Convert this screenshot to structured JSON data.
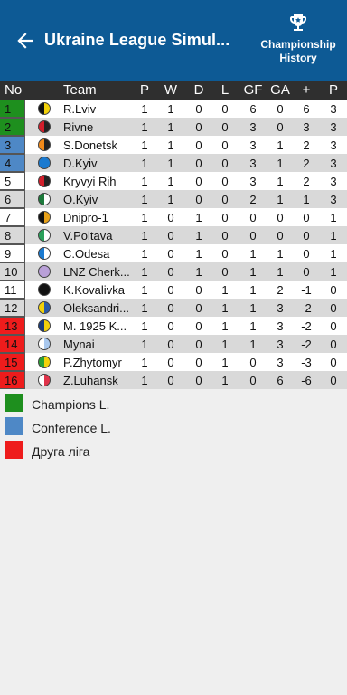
{
  "appbar": {
    "title": "Ukraine League Simul...",
    "history_label_1": "Championship",
    "history_label_2": "History",
    "color": "#0d5a95"
  },
  "columns": {
    "no": "No",
    "team": "Team",
    "p": "P",
    "w": "W",
    "d": "D",
    "l": "L",
    "gf": "GF",
    "ga": "GA",
    "pm": "+",
    "pts": "P"
  },
  "rows": [
    {
      "no": "1",
      "team": "R.Lviv",
      "p": "1",
      "w": "1",
      "d": "0",
      "l": "0",
      "gf": "6",
      "ga": "0",
      "pm": "6",
      "pts": "3",
      "zone": "#1e8f1e",
      "logo": [
        "#111111",
        "#f2d10a"
      ]
    },
    {
      "no": "2",
      "team": "Rivne",
      "p": "1",
      "w": "1",
      "d": "0",
      "l": "0",
      "gf": "3",
      "ga": "0",
      "pm": "3",
      "pts": "3",
      "zone": "#1e8f1e",
      "logo": [
        "#d21e2b",
        "#222222"
      ]
    },
    {
      "no": "3",
      "team": "S.Donetsk",
      "p": "1",
      "w": "1",
      "d": "0",
      "l": "0",
      "gf": "3",
      "ga": "1",
      "pm": "2",
      "pts": "3",
      "zone": "#4e88c6",
      "logo": [
        "#f28a1a",
        "#222222"
      ]
    },
    {
      "no": "4",
      "team": "D.Kyiv",
      "p": "1",
      "w": "1",
      "d": "0",
      "l": "0",
      "gf": "3",
      "ga": "1",
      "pm": "2",
      "pts": "3",
      "zone": "#4e88c6",
      "logo": [
        "#1a7ad0",
        "#1a7ad0"
      ]
    },
    {
      "no": "5",
      "team": "Kryvyi Rih",
      "p": "1",
      "w": "1",
      "d": "0",
      "l": "0",
      "gf": "3",
      "ga": "1",
      "pm": "2",
      "pts": "3",
      "zone": "",
      "logo": [
        "#d21e2b",
        "#222222"
      ]
    },
    {
      "no": "6",
      "team": "O.Kyiv",
      "p": "1",
      "w": "1",
      "d": "0",
      "l": "0",
      "gf": "2",
      "ga": "1",
      "pm": "1",
      "pts": "3",
      "zone": "",
      "logo": [
        "#1c7a3b",
        "#ffffff"
      ]
    },
    {
      "no": "7",
      "team": "Dnipro-1",
      "p": "1",
      "w": "0",
      "d": "1",
      "l": "0",
      "gf": "0",
      "ga": "0",
      "pm": "0",
      "pts": "1",
      "zone": "",
      "logo": [
        "#111111",
        "#e8a21a"
      ]
    },
    {
      "no": "8",
      "team": "V.Poltava",
      "p": "1",
      "w": "0",
      "d": "1",
      "l": "0",
      "gf": "0",
      "ga": "0",
      "pm": "0",
      "pts": "1",
      "zone": "",
      "logo": [
        "#2aa05a",
        "#ffffff"
      ]
    },
    {
      "no": "9",
      "team": "C.Odesa",
      "p": "1",
      "w": "0",
      "d": "1",
      "l": "0",
      "gf": "1",
      "ga": "1",
      "pm": "0",
      "pts": "1",
      "zone": "",
      "logo": [
        "#1a7ad0",
        "#ffffff"
      ]
    },
    {
      "no": "10",
      "team": "LNZ Cherk...",
      "p": "1",
      "w": "0",
      "d": "1",
      "l": "0",
      "gf": "1",
      "ga": "1",
      "pm": "0",
      "pts": "1",
      "zone": "",
      "logo": [
        "#b9a0d8",
        "#b9a0d8"
      ]
    },
    {
      "no": "11",
      "team": "K.Kovalivka",
      "p": "1",
      "w": "0",
      "d": "0",
      "l": "1",
      "gf": "1",
      "ga": "2",
      "pm": "-1",
      "pts": "0",
      "zone": "",
      "logo": [
        "#111111",
        "#111111"
      ]
    },
    {
      "no": "12",
      "team": "Oleksandri...",
      "p": "1",
      "w": "0",
      "d": "0",
      "l": "1",
      "gf": "1",
      "ga": "3",
      "pm": "-2",
      "pts": "0",
      "zone": "",
      "logo": [
        "#f2d10a",
        "#2a5aa8"
      ]
    },
    {
      "no": "13",
      "team": "M. 1925 K...",
      "p": "1",
      "w": "0",
      "d": "0",
      "l": "1",
      "gf": "1",
      "ga": "3",
      "pm": "-2",
      "pts": "0",
      "zone": "#ee1c1c",
      "logo": [
        "#1a3c7a",
        "#f2d10a"
      ]
    },
    {
      "no": "14",
      "team": "Mynai",
      "p": "1",
      "w": "0",
      "d": "0",
      "l": "1",
      "gf": "1",
      "ga": "3",
      "pm": "-2",
      "pts": "0",
      "zone": "#ee1c1c",
      "logo": [
        "#ffffff",
        "#a9c8ee"
      ]
    },
    {
      "no": "15",
      "team": "P.Zhytomyr",
      "p": "1",
      "w": "0",
      "d": "0",
      "l": "1",
      "gf": "0",
      "ga": "3",
      "pm": "-3",
      "pts": "0",
      "zone": "#ee1c1c",
      "logo": [
        "#2aa035",
        "#f2d10a"
      ]
    },
    {
      "no": "16",
      "team": "Z.Luhansk",
      "p": "1",
      "w": "0",
      "d": "0",
      "l": "1",
      "gf": "0",
      "ga": "6",
      "pm": "-6",
      "pts": "0",
      "zone": "#ee1c1c",
      "logo": [
        "#ffffff",
        "#e0334a"
      ]
    }
  ],
  "legend": [
    {
      "label": "Champions L.",
      "color": "#1e8f1e"
    },
    {
      "label": "Conference L.",
      "color": "#4e88c6"
    },
    {
      "label": "Друга ліга",
      "color": "#ee1c1c"
    }
  ]
}
